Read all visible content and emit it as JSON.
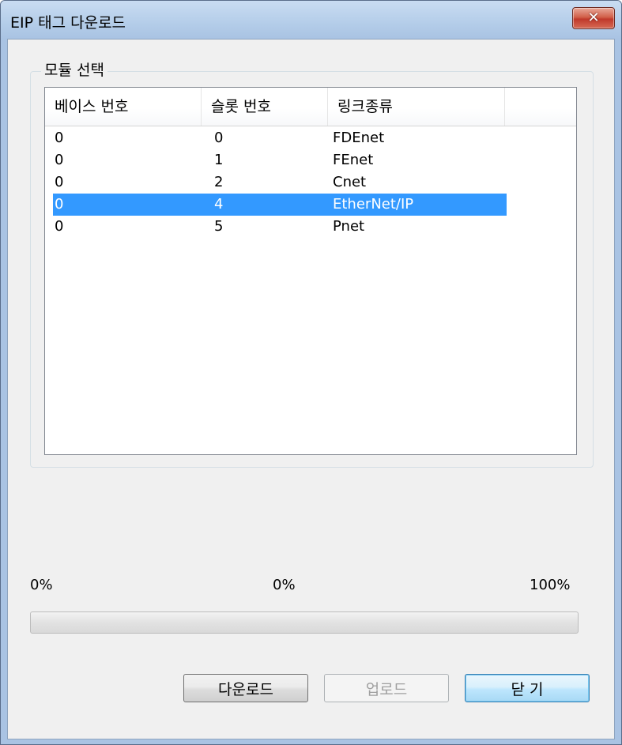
{
  "window": {
    "title": "EIP 태그 다운로드",
    "close_symbol": "✕",
    "close_icon": "close-icon"
  },
  "group": {
    "label": "모듈 선택"
  },
  "list": {
    "columns": [
      "베이스 번호",
      "슬롯 번호",
      "링크종류",
      ""
    ],
    "rows": [
      {
        "base": "0",
        "slot": "0",
        "link": "FDEnet",
        "selected": false
      },
      {
        "base": "0",
        "slot": "1",
        "link": "FEnet",
        "selected": false
      },
      {
        "base": "0",
        "slot": "2",
        "link": "Cnet",
        "selected": false
      },
      {
        "base": "0",
        "slot": "4",
        "link": "EtherNet/IP",
        "selected": true
      },
      {
        "base": "0",
        "slot": "5",
        "link": "Pnet",
        "selected": false
      }
    ],
    "selection_color": "#3399ff"
  },
  "progress": {
    "label_min": "0%",
    "label_current": "0%",
    "label_max": "100%",
    "value": 0
  },
  "buttons": {
    "download": "다운로드",
    "upload": "업로드",
    "close": "닫 기"
  }
}
